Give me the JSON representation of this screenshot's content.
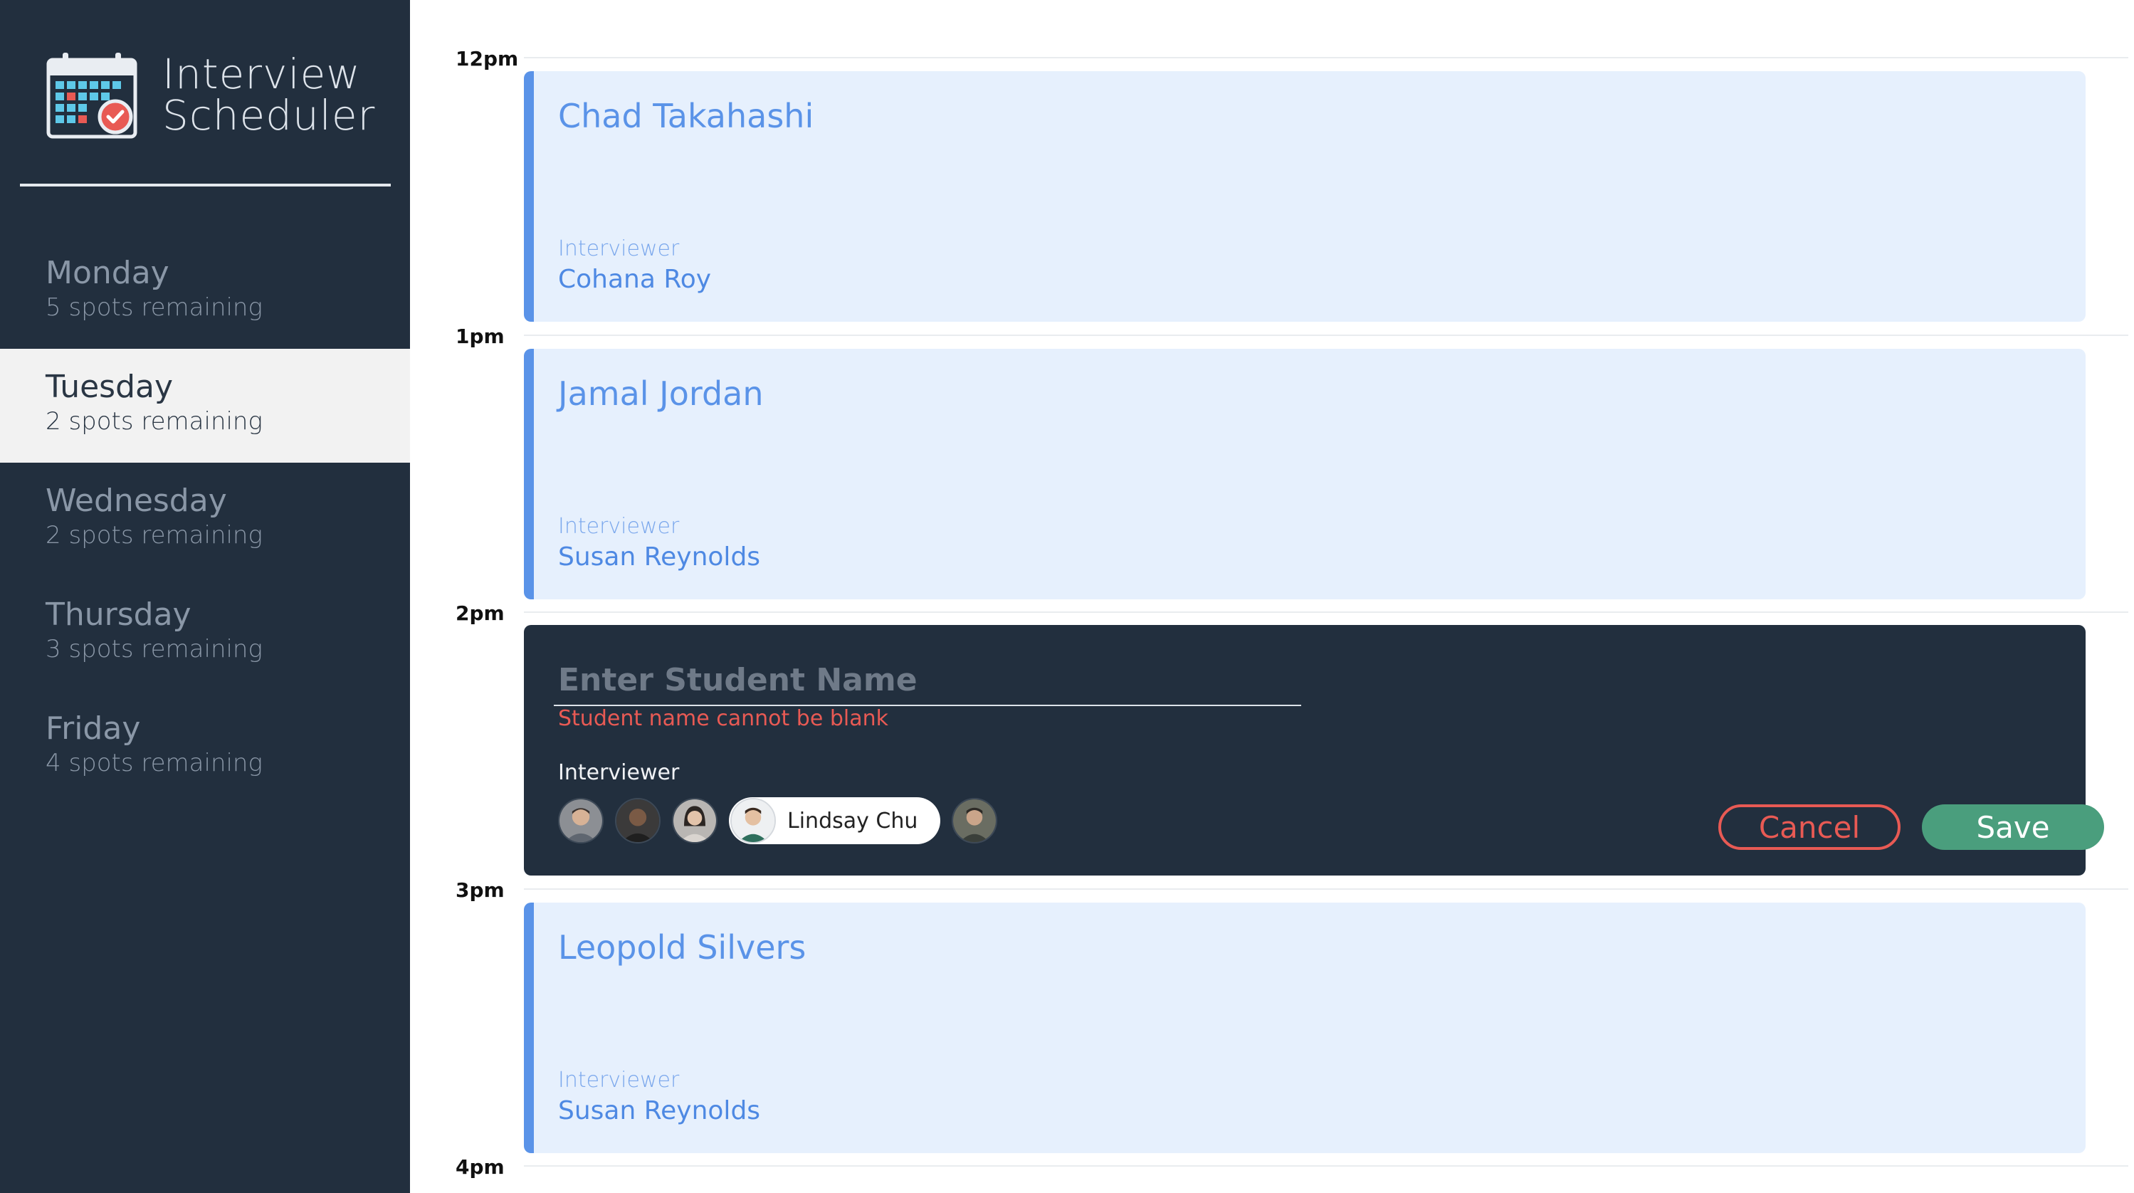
{
  "app": {
    "title_line1": "Interview",
    "title_line2": "Scheduler"
  },
  "sidebar": {
    "days": [
      {
        "name": "Monday",
        "spots": "5 spots remaining",
        "selected": false
      },
      {
        "name": "Tuesday",
        "spots": "2 spots remaining",
        "selected": true
      },
      {
        "name": "Wednesday",
        "spots": "2 spots remaining",
        "selected": false
      },
      {
        "name": "Thursday",
        "spots": "3 spots remaining",
        "selected": false
      },
      {
        "name": "Friday",
        "spots": "4 spots remaining",
        "selected": false
      }
    ]
  },
  "schedule": {
    "times": [
      "12pm",
      "1pm",
      "2pm",
      "3pm",
      "4pm"
    ],
    "appointments": [
      {
        "student": "Chad Takahashi",
        "interviewer_label": "Interviewer",
        "interviewer": "Cohana Roy"
      },
      {
        "student": "Jamal Jordan",
        "interviewer_label": "Interviewer",
        "interviewer": "Susan Reynolds"
      },
      {
        "student": "Leopold Silvers",
        "interviewer_label": "Interviewer",
        "interviewer": "Susan Reynolds"
      }
    ],
    "form": {
      "placeholder": "Enter Student Name",
      "value": "",
      "error": "Student name cannot be blank",
      "interviewer_label": "Interviewer",
      "selected_interviewer": "Lindsay Chu",
      "cancel_label": "Cancel",
      "save_label": "Save"
    }
  },
  "colors": {
    "sidebar_bg": "#222f3e",
    "appointment_bg": "#e6f0fd",
    "accent_blue": "#5a93e8",
    "error_red": "#e85a54",
    "save_green": "#4a9e7d"
  }
}
